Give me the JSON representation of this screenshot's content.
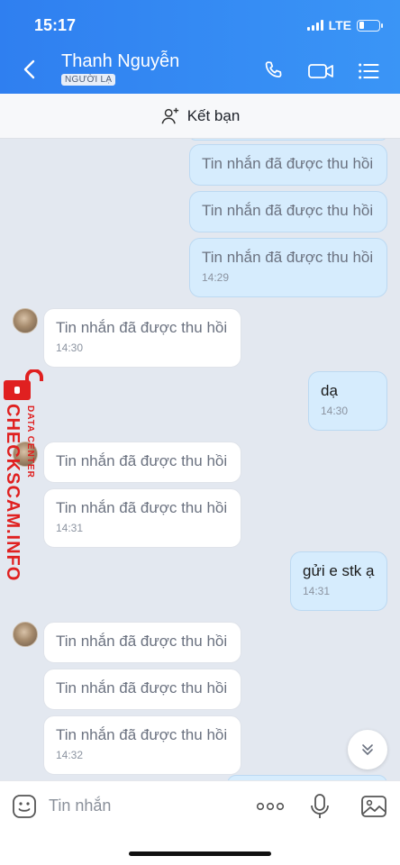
{
  "status_bar": {
    "time": "15:17",
    "network": "LTE"
  },
  "header": {
    "contact_name": "Thanh Nguyễn",
    "badge": "NGƯỜI LẠ"
  },
  "add_friend": {
    "label": "Kết bạn"
  },
  "messages": [
    {
      "text": "Tin nhắn đã được thu hồi"
    },
    {
      "text": "Tin nhắn đã được thu hồi"
    },
    {
      "text": "Tin nhắn đã được thu hồi",
      "time": "14:29"
    },
    {
      "text": "Tin nhắn đã được thu hồi",
      "time": "14:30"
    },
    {
      "text": "dạ",
      "time": "14:30"
    },
    {
      "text": "Tin nhắn đã được thu hồi"
    },
    {
      "text": "Tin nhắn đã được thu hồi",
      "time": "14:31"
    },
    {
      "text": "gửi e stk ạ",
      "time": "14:31"
    },
    {
      "text": "Tin nhắn đã được thu hồi"
    },
    {
      "text": "Tin nhắn đã được thu hồi"
    },
    {
      "text": "Tin nhắn đã được thu hồi",
      "time": "14:32"
    }
  ],
  "watermark": {
    "main": "CHECKSCAM.INFO",
    "small": "DATA CENTER"
  },
  "input": {
    "placeholder": "Tin nhắn"
  },
  "colors": {
    "header": "#3a8cf3",
    "outgoing_bubble": "#d6ecfd",
    "incoming_bubble": "#ffffff",
    "watermark": "#e02020"
  }
}
